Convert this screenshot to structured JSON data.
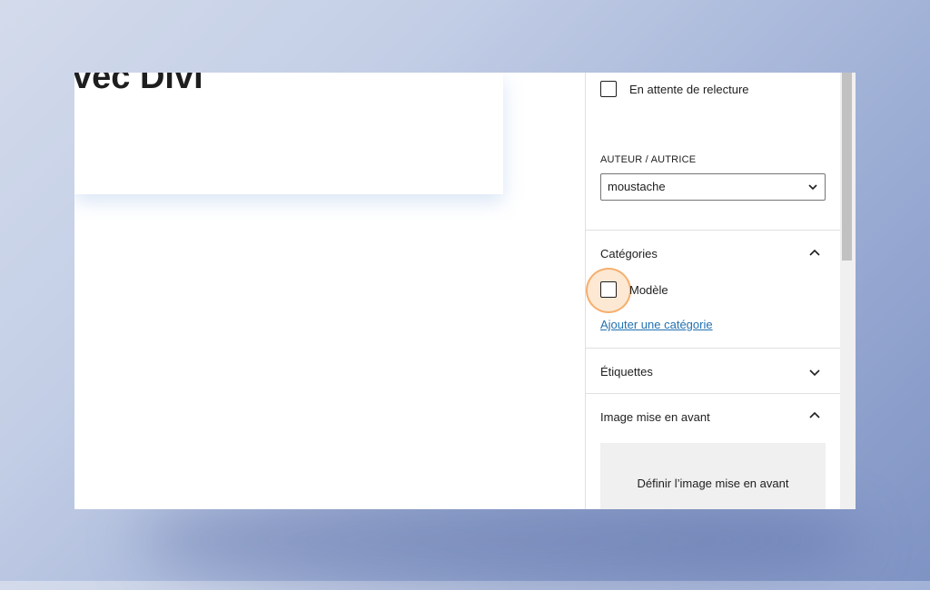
{
  "editor": {
    "title": "vec Divi"
  },
  "sidebar": {
    "pending_review": {
      "label": "En attente de relecture",
      "checked": false
    },
    "author": {
      "label": "AUTEUR / AUTRICE",
      "value": "moustache"
    },
    "categories": {
      "title": "Catégories",
      "expanded": true,
      "items": [
        {
          "label": "Modèle",
          "checked": false
        }
      ],
      "add_link": "Ajouter une catégorie"
    },
    "tags": {
      "title": "Étiquettes",
      "expanded": false
    },
    "featured_image": {
      "title": "Image mise en avant",
      "expanded": true,
      "button": "Définir l’image mise en avant"
    }
  },
  "colors": {
    "link": "#2271b1",
    "highlight": "#f5aa64"
  }
}
